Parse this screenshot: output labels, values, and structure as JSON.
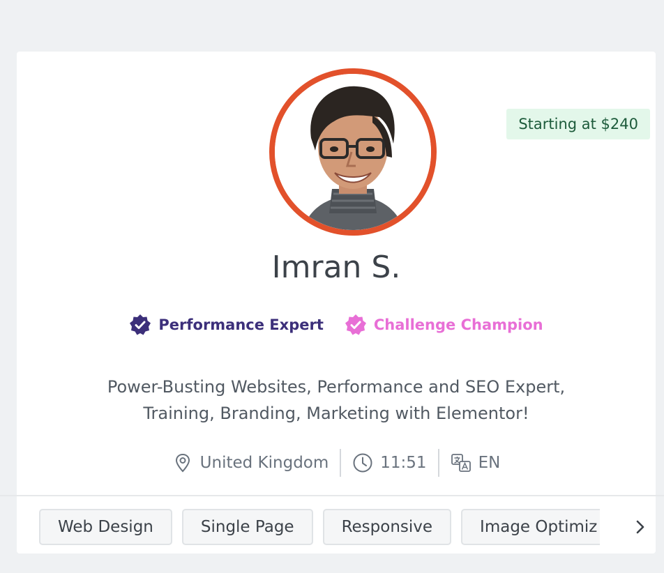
{
  "profile": {
    "name": "Imran S.",
    "price": "Starting at $240",
    "badges": [
      {
        "label": "Performance Expert",
        "color": "#3c2f7a"
      },
      {
        "label": "Challenge Champion",
        "color": "#e86fd6"
      }
    ],
    "tagline_line1": "Power-Busting Websites, Performance and SEO Expert,",
    "tagline_line2": "Training, Branding, Marketing with Elementor!",
    "location": "United Kingdom",
    "time": "11:51",
    "language": "EN",
    "avatar_ring_color": "#e2512b"
  },
  "tags": [
    "Web Design",
    "Single Page",
    "Responsive",
    "Image Optimiz"
  ],
  "icons": {
    "location": "map-pin-icon",
    "time": "clock-icon",
    "language": "translate-icon",
    "next": "chevron-right-icon",
    "badge": "verified-badge-icon"
  }
}
